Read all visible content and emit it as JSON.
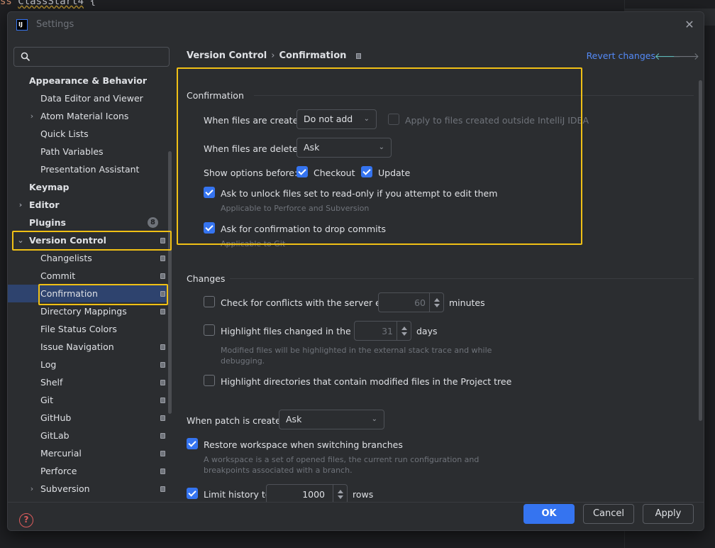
{
  "editor": {
    "keyword": "ss",
    "class_name": "ClassStart4",
    "brace": "{"
  },
  "dialog": {
    "title": "Settings",
    "app_icon_text": "IJ"
  },
  "search": {
    "placeholder": "",
    "value": ""
  },
  "tree": [
    {
      "label": "Appearance & Behavior",
      "bold": true,
      "level": 0,
      "chevron": ""
    },
    {
      "label": "Data Editor and Viewer",
      "level": 1
    },
    {
      "label": "Atom Material Icons",
      "level": 1,
      "chevron": "›"
    },
    {
      "label": "Quick Lists",
      "level": 1
    },
    {
      "label": "Path Variables",
      "level": 1
    },
    {
      "label": "Presentation Assistant",
      "level": 1
    },
    {
      "label": "Keymap",
      "bold": true,
      "level": 0
    },
    {
      "label": "Editor",
      "bold": true,
      "level": 0,
      "chevron": "›"
    },
    {
      "label": "Plugins",
      "bold": true,
      "level": 0,
      "badge": "8"
    },
    {
      "label": "Version Control",
      "bold": true,
      "level": 0,
      "chevron": "⌄",
      "project": true
    },
    {
      "label": "Changelists",
      "level": 1,
      "project": true
    },
    {
      "label": "Commit",
      "level": 1,
      "project": true
    },
    {
      "label": "Confirmation",
      "level": 1,
      "project": true,
      "selected": true
    },
    {
      "label": "Directory Mappings",
      "level": 1,
      "project": true
    },
    {
      "label": "File Status Colors",
      "level": 1
    },
    {
      "label": "Issue Navigation",
      "level": 1,
      "project": true
    },
    {
      "label": "Log",
      "level": 1,
      "project": true
    },
    {
      "label": "Shelf",
      "level": 1,
      "project": true
    },
    {
      "label": "Git",
      "level": 1,
      "project": true
    },
    {
      "label": "GitHub",
      "level": 1,
      "project": true
    },
    {
      "label": "GitLab",
      "level": 1,
      "project": true
    },
    {
      "label": "Mercurial",
      "level": 1,
      "project": true
    },
    {
      "label": "Perforce",
      "level": 1,
      "project": true
    },
    {
      "label": "Subversion",
      "level": 1,
      "chevron": "›",
      "project": true
    }
  ],
  "header": {
    "crumb1": "Version Control",
    "crumb_sep": "›",
    "crumb2": "Confirmation",
    "revert": "Revert changes",
    "back_arrow": "🡐",
    "forward_arrow": "🡒"
  },
  "confirmation": {
    "title": "Confirmation",
    "created_label": "When files are created:",
    "created_value": "Do not add",
    "apply_outside_label": "Apply to files created outside IntelliJ IDEA",
    "apply_outside_checked": false,
    "deleted_label": "When files are deleted:",
    "deleted_value": "Ask",
    "show_options_label": "Show options before:",
    "checkout_label": "Checkout",
    "checkout_checked": true,
    "update_label": "Update",
    "update_checked": true,
    "unlock_label": "Ask to unlock files set to read-only if you attempt to edit them",
    "unlock_checked": true,
    "unlock_hint": "Applicable to Perforce and Subversion",
    "drop_label": "Ask for confirmation to drop commits",
    "drop_checked": true,
    "drop_hint": "Applicable to Git"
  },
  "changes": {
    "title": "Changes",
    "conflicts_label": "Check for conflicts with the server every",
    "conflicts_checked": false,
    "conflicts_value": "60",
    "conflicts_unit": "minutes",
    "highlight_label": "Highlight files changed in the last",
    "highlight_checked": false,
    "highlight_value": "31",
    "highlight_unit": "days",
    "highlight_hint_1": "Modified files will be highlighted in the external stack trace and while",
    "highlight_hint_2": "debugging.",
    "dirs_label": "Highlight directories that contain modified files in the Project tree",
    "dirs_checked": false
  },
  "patch": {
    "label": "When patch is created:",
    "value": "Ask",
    "restore_label": "Restore workspace when switching branches",
    "restore_checked": true,
    "restore_hint_1": "A workspace is a set of opened files, the current run configuration and",
    "restore_hint_2": "breakpoints associated with a branch.",
    "limit_label": "Limit history to",
    "limit_checked": true,
    "limit_value": "1000",
    "limit_unit": "rows"
  },
  "footer": {
    "help": "?",
    "ok": "OK",
    "cancel": "Cancel",
    "apply": "Apply"
  },
  "colors": {
    "accent": "#3574f0",
    "highlight": "#f0c015",
    "link": "#548af7",
    "selection": "#2e436e"
  }
}
